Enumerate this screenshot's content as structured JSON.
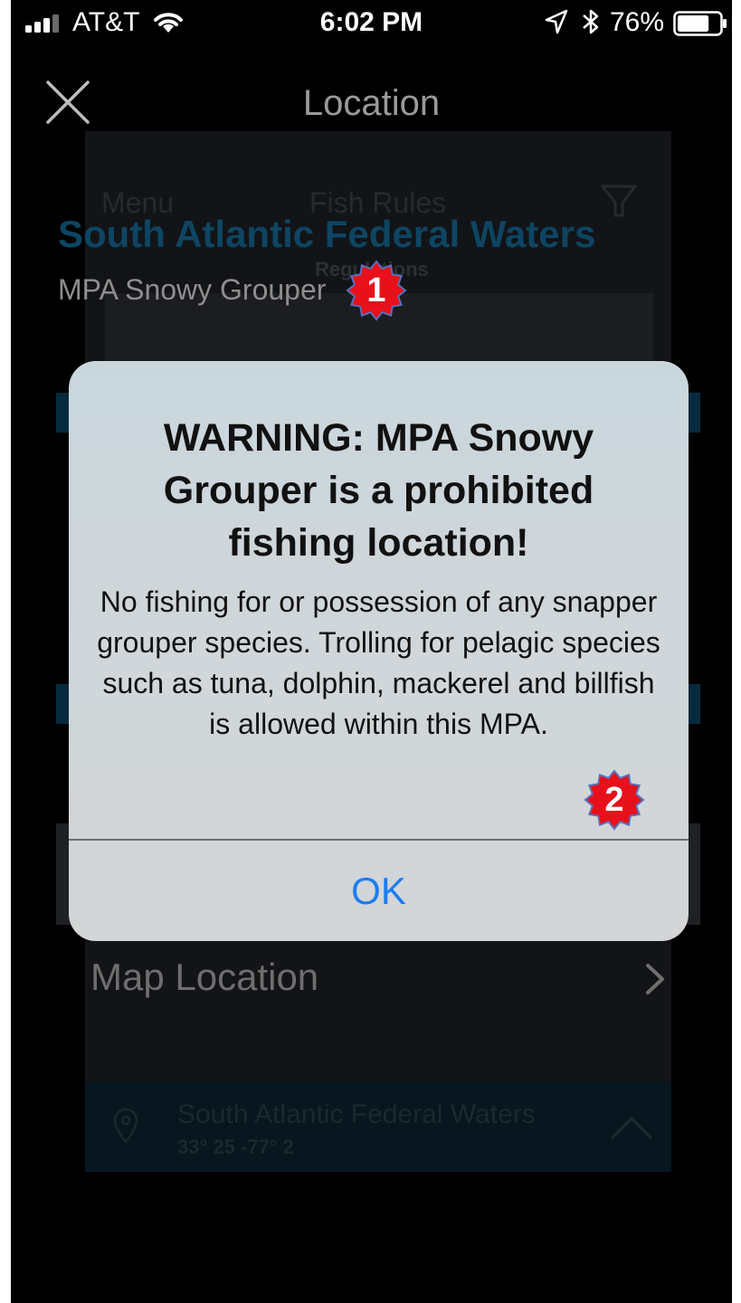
{
  "status_bar": {
    "carrier": "AT&T",
    "time": "6:02 PM",
    "battery_percent": "76%",
    "battery_level": 0.76,
    "icons": [
      "cellular-signal-icon",
      "wifi-icon",
      "location-arrow-icon",
      "bluetooth-icon",
      "battery-icon"
    ]
  },
  "nav": {
    "title": "Location",
    "close_icon": "close-icon"
  },
  "background": {
    "menu_label": "Menu",
    "fish_rules_label": "Fish Rules",
    "filter_icon": "filter-icon",
    "regulations_label": "Regulations",
    "location_title": "South Atlantic Federal Waters",
    "location_subtitle": "MPA Snowy Grouper",
    "map_location_label": "Map Location",
    "bottom_bar": {
      "pin_icon": "location-pin-icon",
      "name": "South Atlantic Federal Waters",
      "coords": "33° 25 -77° 2"
    }
  },
  "annotations": {
    "badge_1": "1",
    "badge_2": "2",
    "badge_color": "#e8101a"
  },
  "alert": {
    "title": "WARNING: MPA Snowy Grouper is a prohibited fishing location!",
    "message": "No fishing for or possession of any snapper grouper species. Trolling for pelagic species such as tuna, dolphin, mackerel and billfish is allowed within this MPA.",
    "ok_label": "OK",
    "ok_color": "#1d7cf2"
  }
}
